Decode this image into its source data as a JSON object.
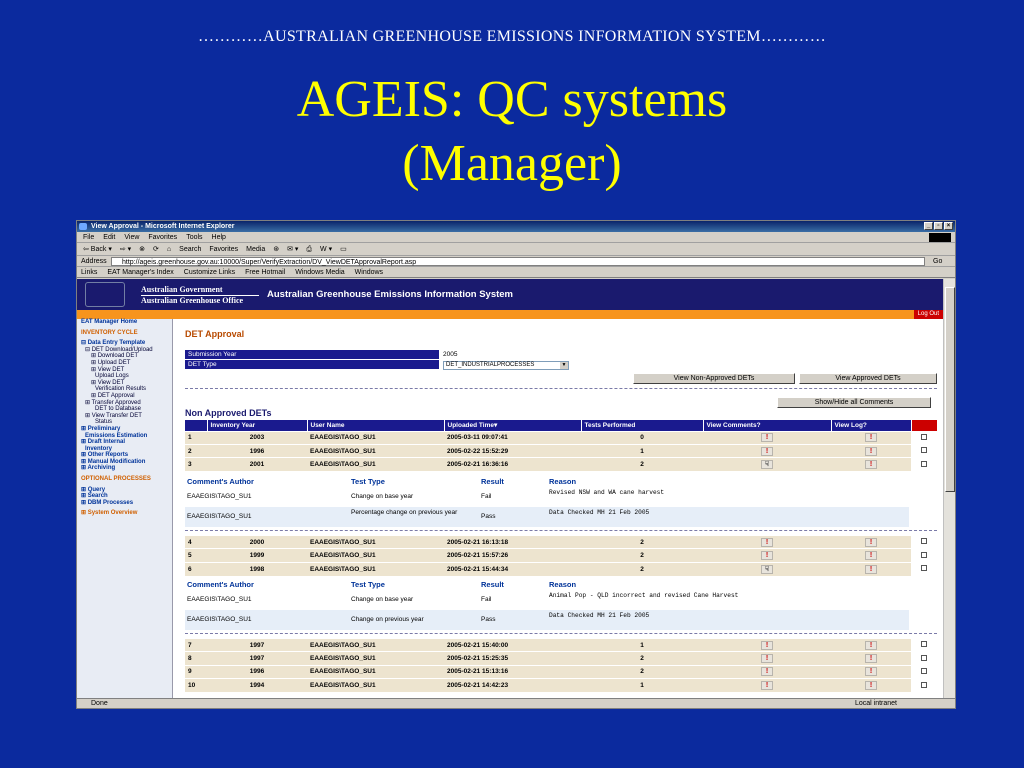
{
  "slide": {
    "caption": "…………AUSTRALIAN GREENHOUSE EMISSIONS INFORMATION SYSTEM…………",
    "title_line1": "AGEIS: QC systems",
    "title_line2": "(Manager)"
  },
  "browser": {
    "title": "View Approval - Microsoft Internet Explorer",
    "menu": [
      "File",
      "Edit",
      "View",
      "Favorites",
      "Tools",
      "Help"
    ],
    "toolbar": [
      "⇦ Back ▾",
      "⇨ ▾",
      "⊗",
      "⟳",
      "⌂",
      "Search",
      "Favorites",
      "Media",
      "⊛",
      "✉ ▾",
      "⎙",
      "W ▾",
      "▭"
    ],
    "address_label": "Address",
    "address_url": "http://ageis.greenhouse.gov.au:10000/Super/VerifyExtraction/DV_ViewDETApprovalReport.asp",
    "go_label": "Go",
    "links_label": "Links",
    "links": [
      "EAT Manager's Index",
      "Customize Links",
      "Free Hotmail",
      "Windows Media",
      "Windows"
    ],
    "status_left": "Done",
    "status_right": "Local intranet"
  },
  "site": {
    "gov_line1": "Australian Government",
    "gov_line2": "Australian Greenhouse Office",
    "system_name": "Australian Greenhouse Emissions Information System",
    "logout": "Log Out"
  },
  "sidebar": {
    "items": [
      {
        "label": "EAT Manager Home",
        "cls": "h"
      },
      {
        "label": "",
        "cls": ""
      },
      {
        "label": "INVENTORY CYCLE",
        "cls": "o"
      },
      {
        "label": "",
        "cls": ""
      },
      {
        "label": "⊟ Data Entry Template",
        "cls": "h"
      },
      {
        "label": "⊟ DET Download/Upload",
        "cls": "i1"
      },
      {
        "label": "⊞ Download DET",
        "cls": "i2"
      },
      {
        "label": "⊞ Upload DET",
        "cls": "i2"
      },
      {
        "label": "⊞ View DET",
        "cls": "i2"
      },
      {
        "label": "Upload Logs",
        "cls": "i3"
      },
      {
        "label": "⊞ View DET",
        "cls": "i2"
      },
      {
        "label": "Verification Results",
        "cls": "i3"
      },
      {
        "label": "⊞ DET Approval",
        "cls": "i2"
      },
      {
        "label": "⊞ Transfer Approved",
        "cls": "i1"
      },
      {
        "label": "DET to Database",
        "cls": "i3"
      },
      {
        "label": "⊞ View Transfer DET",
        "cls": "i1"
      },
      {
        "label": "Status",
        "cls": "i3"
      },
      {
        "label": "⊞ Preliminary",
        "cls": "h"
      },
      {
        "label": "Emissions Estimation",
        "cls": "h i1"
      },
      {
        "label": "⊞ Draft Internal",
        "cls": "h"
      },
      {
        "label": "Inventory",
        "cls": "h i1"
      },
      {
        "label": "⊞ Other Reports",
        "cls": "h"
      },
      {
        "label": "⊞ Manual Modification",
        "cls": "h"
      },
      {
        "label": "⊞ Archiving",
        "cls": "h"
      },
      {
        "label": "",
        "cls": ""
      },
      {
        "label": "OPTIONAL PROCESSES",
        "cls": "o"
      },
      {
        "label": "",
        "cls": ""
      },
      {
        "label": "⊞ Query",
        "cls": "h"
      },
      {
        "label": "⊞ Search",
        "cls": "h"
      },
      {
        "label": "⊞ DBM Processes",
        "cls": "h"
      },
      {
        "label": "",
        "cls": ""
      },
      {
        "label": "⊞ System Overview",
        "cls": "o"
      }
    ]
  },
  "main": {
    "page_title": "DET Approval",
    "submission_year_label": "Submission Year",
    "submission_year_value": "2005",
    "det_type_label": "DET Type",
    "det_type_value": "DET_INDUSTRIALPROCESSES",
    "btn_non_approved": "View Non-Approved DETs",
    "btn_approved": "View Approved DETs",
    "btn_show_hide": "Show/Hide all Comments",
    "section_title": "Non Approved DETs",
    "columns": [
      "",
      "Inventory Year",
      "User Name",
      "Uploaded Time▾",
      "Tests Performed",
      "View Comments?",
      "View Log?",
      ""
    ],
    "comment_headers": [
      "Comment's Author",
      "Test Type",
      "Result",
      "Reason"
    ],
    "rows_a": [
      {
        "n": "1",
        "year": "2003",
        "user": "EAAEGIS\\TAGO_SU1",
        "time": "2005-03-11 09:07:41",
        "tests": "0",
        "cmt": "!",
        "log": "!"
      },
      {
        "n": "2",
        "year": "1996",
        "user": "EAAEGIS\\TAGO_SU1",
        "time": "2005-02-22 15:52:29",
        "tests": "1",
        "cmt": "!",
        "log": "!"
      },
      {
        "n": "3",
        "year": "2001",
        "user": "EAAEGIS\\TAGO_SU1",
        "time": "2005-02-21 16:36:16",
        "tests": "2",
        "cmt": "☟",
        "log": "!"
      }
    ],
    "comments_a": [
      {
        "author": "EAAEGIS\\TAGO_SU1",
        "test": "Change on base year",
        "result": "Fail",
        "reason": "Revised NSW and WA cane harvest"
      },
      {
        "author": "EAAEGIS\\TAGO_SU1",
        "test": "Percentage change on previous year",
        "result": "Pass",
        "reason": "Data Checked MH 21 Feb 2005"
      }
    ],
    "rows_b": [
      {
        "n": "4",
        "year": "2000",
        "user": "EAAEGIS\\TAGO_SU1",
        "time": "2005-02-21 16:13:18",
        "tests": "2",
        "cmt": "!",
        "log": "!"
      },
      {
        "n": "5",
        "year": "1999",
        "user": "EAAEGIS\\TAGO_SU1",
        "time": "2005-02-21 15:57:26",
        "tests": "2",
        "cmt": "!",
        "log": "!"
      },
      {
        "n": "6",
        "year": "1998",
        "user": "EAAEGIS\\TAGO_SU1",
        "time": "2005-02-21 15:44:34",
        "tests": "2",
        "cmt": "☟",
        "log": "!"
      }
    ],
    "comments_b": [
      {
        "author": "EAAEGIS\\TAGO_SU1",
        "test": "Change on base year",
        "result": "Fail",
        "reason": "Animal Pop - QLD incorrect and revised Cane Harvest"
      },
      {
        "author": "EAAEGIS\\TAGO_SU1",
        "test": "Change on previous year",
        "result": "Pass",
        "reason": "Data Checked MH 21 Feb 2005"
      }
    ],
    "rows_c": [
      {
        "n": "7",
        "year": "1997",
        "user": "EAAEGIS\\TAGO_SU1",
        "time": "2005-02-21 15:40:00",
        "tests": "1",
        "cmt": "!",
        "log": "!"
      },
      {
        "n": "8",
        "year": "1997",
        "user": "EAAEGIS\\TAGO_SU1",
        "time": "2005-02-21 15:25:35",
        "tests": "2",
        "cmt": "!",
        "log": "!"
      },
      {
        "n": "9",
        "year": "1996",
        "user": "EAAEGIS\\TAGO_SU1",
        "time": "2005-02-21 15:13:16",
        "tests": "2",
        "cmt": "!",
        "log": "!"
      },
      {
        "n": "10",
        "year": "1994",
        "user": "EAAEGIS\\TAGO_SU1",
        "time": "2005-02-21 14:42:23",
        "tests": "1",
        "cmt": "!",
        "log": "!"
      }
    ]
  }
}
